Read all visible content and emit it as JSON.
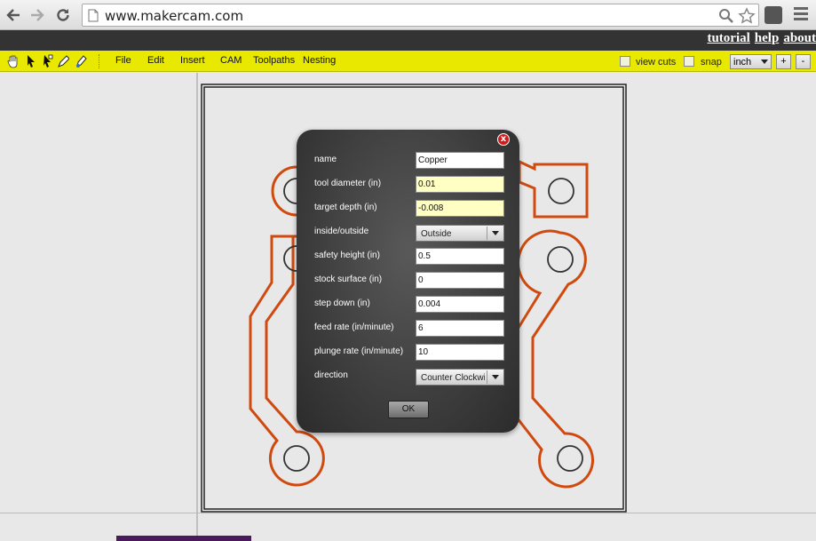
{
  "browser": {
    "url": "www.makercam.com"
  },
  "topbar": {
    "links": [
      "tutorial",
      "help",
      "about"
    ]
  },
  "toolbar": {
    "menus": [
      "File",
      "Edit",
      "Insert",
      "CAM",
      "Toolpaths",
      "Nesting"
    ],
    "view_cuts_label": "view cuts",
    "snap_label": "snap",
    "unit_value": "inch",
    "plus_label": "+",
    "minus_label": "-"
  },
  "dialog": {
    "close_label": "x",
    "fields": [
      {
        "label": "name",
        "value": "Copper",
        "highlight": false,
        "type": "text"
      },
      {
        "label": "tool diameter (in)",
        "value": "0.01",
        "highlight": true,
        "type": "text"
      },
      {
        "label": "target depth (in)",
        "value": "-0.008",
        "highlight": true,
        "type": "text"
      },
      {
        "label": "inside/outside",
        "value": "Outside",
        "type": "select"
      },
      {
        "label": "safety height (in)",
        "value": "0.5",
        "highlight": false,
        "type": "text"
      },
      {
        "label": "stock surface (in)",
        "value": "0",
        "highlight": false,
        "type": "text"
      },
      {
        "label": "step down (in)",
        "value": "0.004",
        "highlight": false,
        "type": "text"
      },
      {
        "label": "feed rate (in/minute)",
        "value": "6",
        "highlight": false,
        "type": "text"
      },
      {
        "label": "plunge rate (in/minute)",
        "value": "10",
        "highlight": false,
        "type": "text"
      },
      {
        "label": "direction",
        "value": "Counter Clockwise",
        "type": "select"
      }
    ],
    "ok_label": "OK"
  },
  "colors": {
    "toolbar": "#e8e800",
    "topbar": "#333333",
    "trace": "#d04a10",
    "highlight_field": "#ffffc4"
  },
  "icons": [
    "back-icon",
    "forward-icon",
    "reload-icon",
    "page-icon",
    "zoom-icon",
    "star-icon",
    "extension-icon",
    "chrome-menu-icon",
    "hand-tool-icon",
    "pointer-tool-icon",
    "node-tool-icon",
    "pen-tool-icon",
    "node-edit-tool-icon"
  ]
}
